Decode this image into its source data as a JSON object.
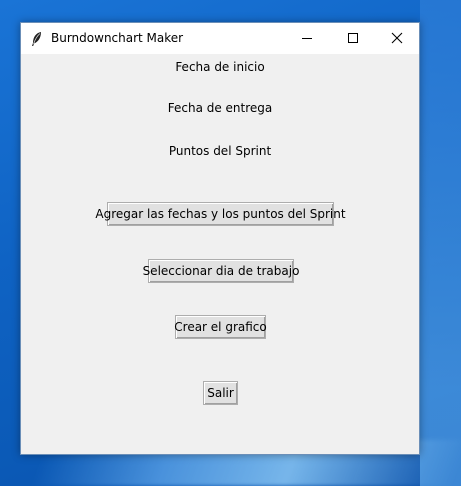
{
  "window": {
    "title": "Burndownchart Maker",
    "controls": {
      "minimize_icon": "minimize-icon",
      "maximize_icon": "maximize-icon",
      "close_icon": "close-icon"
    }
  },
  "labels": {
    "start_date": "Fecha de inicio",
    "delivery_date": "Fecha de entrega",
    "sprint_points": "Puntos del Sprint"
  },
  "buttons": {
    "add_dates_points": "Agregar las fechas y los puntos del Sprint",
    "select_work_day": "Seleccionar dia de trabajo",
    "create_chart": "Crear el grafico",
    "exit": "Salir"
  },
  "colors": {
    "window_bg": "#f0f0f0",
    "titlebar_bg": "#ffffff",
    "button_bg": "#e1e1e1",
    "desktop_bg": "#0f63c4"
  }
}
